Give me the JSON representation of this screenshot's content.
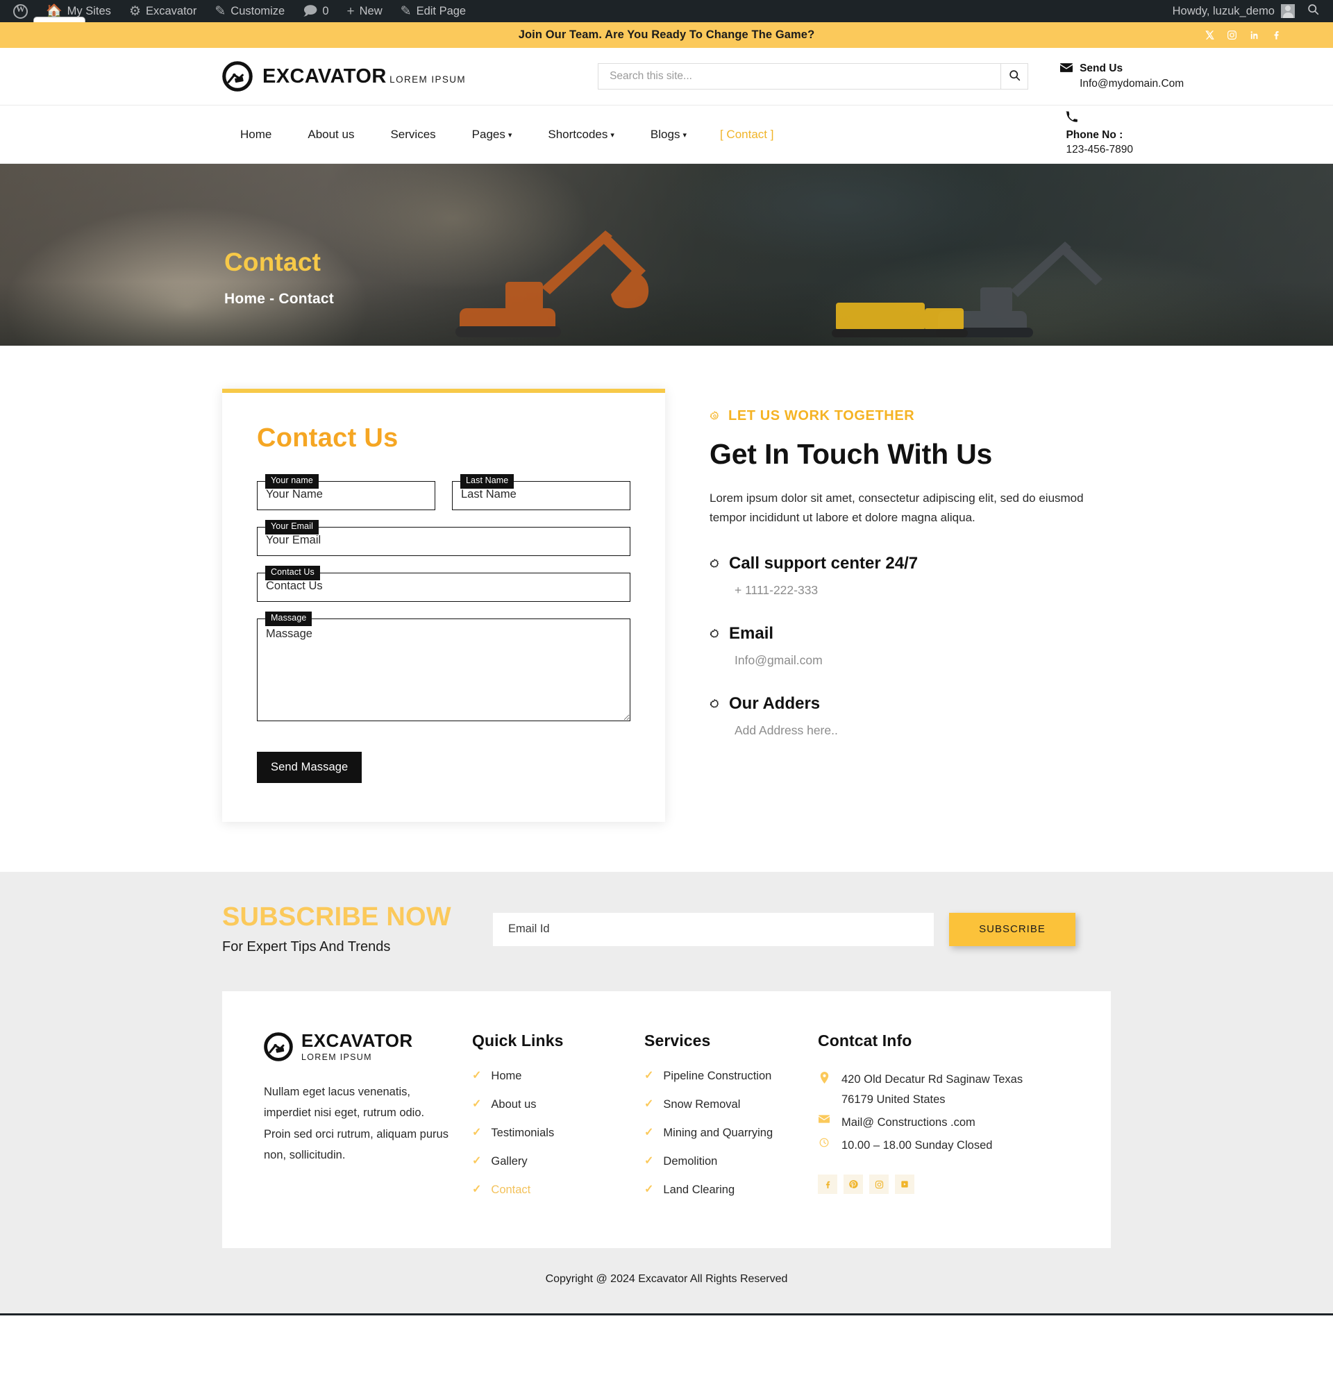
{
  "adminbar": {
    "items": [
      {
        "label": "My Sites",
        "icon": "sites-icon"
      },
      {
        "label": "Excavator",
        "icon": "dashboard-icon"
      },
      {
        "label": "Customize",
        "icon": "brush-icon"
      },
      {
        "label": "0",
        "icon": "comment-icon"
      },
      {
        "label": "New",
        "icon": "plus-icon"
      },
      {
        "label": "Edit Page",
        "icon": "pencil-icon"
      }
    ],
    "howdy": "Howdy, luzuk_demo"
  },
  "topbar": {
    "message": "Join Our Team. Are You Ready To Change The Game?",
    "socials": [
      "x-icon",
      "instagram-icon",
      "linkedin-icon",
      "facebook-icon"
    ]
  },
  "header": {
    "brand_name": "EXCAVATOR",
    "brand_sub": "LOREM IPSUM",
    "search_placeholder": "Search this site...",
    "search_value": "",
    "send_us_title": "Send Us",
    "send_us_value": "Info@mydomain.Com"
  },
  "nav": {
    "items": [
      {
        "label": "Home",
        "caret": false
      },
      {
        "label": "About us",
        "caret": false
      },
      {
        "label": "Services",
        "caret": false
      },
      {
        "label": "Pages",
        "caret": true
      },
      {
        "label": "Shortcodes",
        "caret": true
      },
      {
        "label": "Blogs",
        "caret": true
      }
    ],
    "contact_label": "[ Contact ]",
    "phone_label": "Phone No :",
    "phone_number": "123-456-7890"
  },
  "hero": {
    "title": "Contact",
    "breadcrumb": "Home - Contact"
  },
  "form": {
    "title": "Contact Us",
    "fields": [
      {
        "label": "Your name",
        "placeholder": "Your Name",
        "value": ""
      },
      {
        "label": "Last Name",
        "placeholder": "Last Name",
        "value": ""
      },
      {
        "label": "Your Email",
        "placeholder": "Your Email",
        "value": ""
      },
      {
        "label": "Contact Us",
        "placeholder": "Contact Us",
        "value": ""
      },
      {
        "label": "Massage",
        "placeholder": "Massage",
        "value": ""
      }
    ],
    "submit_label": "Send Massage"
  },
  "info": {
    "eyebrow": "LET US WORK TOGETHER",
    "heading": "Get In Touch With Us",
    "description": "Lorem ipsum dolor sit amet, consectetur adipiscing elit, sed do eiusmod tempor incididunt ut labore et dolore magna aliqua.",
    "blocks": [
      {
        "title": "Call support center 24/7",
        "value": "+ 1111-222-333"
      },
      {
        "title": "Email",
        "value": "Info@gmail.com"
      },
      {
        "title": "Our Adders",
        "value": "Add Address here.."
      }
    ]
  },
  "subscribe": {
    "title": "SUBSCRIBE NOW",
    "subtitle": "For Expert Tips And Trends",
    "placeholder": "Email Id",
    "value": "",
    "button_label": "SUBSCRIBE"
  },
  "footer": {
    "brand_name": "EXCAVATOR",
    "brand_sub": "LOREM IPSUM",
    "description": "Nullam eget lacus venenatis, imperdiet nisi eget, rutrum odio. Proin sed orci rutrum, aliquam purus non, sollicitudin.",
    "quick_links_title": "Quick Links",
    "quick_links": [
      {
        "label": "Home",
        "active": false
      },
      {
        "label": "About us",
        "active": false
      },
      {
        "label": "Testimonials",
        "active": false
      },
      {
        "label": "Gallery",
        "active": false
      },
      {
        "label": "Contact",
        "active": true
      }
    ],
    "services_title": "Services",
    "services": [
      {
        "label": "Pipeline Construction"
      },
      {
        "label": "Snow Removal"
      },
      {
        "label": "Mining and Quarrying"
      },
      {
        "label": "Demolition"
      },
      {
        "label": "Land Clearing"
      }
    ],
    "contact_title": "Contcat Info",
    "address": "420 Old Decatur Rd Saginaw Texas 76179 United States",
    "email": "Mail@ Constructions .com",
    "hours": "10.00 – 18.00 Sunday Closed",
    "socials": [
      "facebook-icon",
      "pinterest-icon",
      "instagram-icon",
      "youtube-icon"
    ]
  },
  "copyright": "Copyright @ 2024 Excavator All Rights Reserved"
}
